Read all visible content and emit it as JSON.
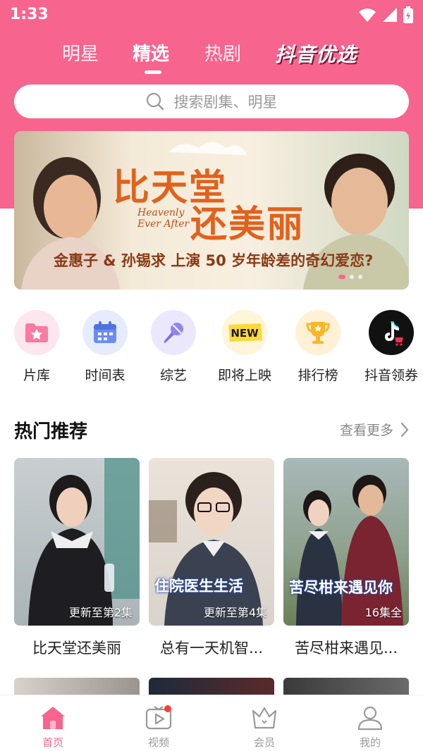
{
  "status_bar": {
    "time": "1:33"
  },
  "top_tabs": {
    "items": [
      "明星",
      "精选",
      "热剧"
    ],
    "active": "精选",
    "brand": "抖音优选"
  },
  "search": {
    "placeholder": "搜索剧集、明星"
  },
  "banner": {
    "title_line1": "比天堂",
    "title_line2": "还美丽",
    "english_title": "Heavenly Ever After",
    "subtitle": "金惠子 & 孙锡求 上演 50 岁年龄差的奇幻爱恋?"
  },
  "quick_nav": [
    {
      "label": "片库",
      "icon": "folder-star-icon"
    },
    {
      "label": "时间表",
      "icon": "calendar-icon"
    },
    {
      "label": "综艺",
      "icon": "microphone-icon"
    },
    {
      "label": "即将上映",
      "icon": "new-badge-icon"
    },
    {
      "label": "排行榜",
      "icon": "trophy-icon"
    },
    {
      "label": "抖音领券",
      "icon": "douyin-cart-icon"
    }
  ],
  "section": {
    "title": "热门推荐",
    "more_label": "查看更多"
  },
  "cards": [
    {
      "title": "比天堂还美丽",
      "badge": "更新至第2集"
    },
    {
      "title": "总有一天机智...",
      "badge": "更新至第4集",
      "poster_text": "住院医生生活"
    },
    {
      "title": "苦尽柑来遇见...",
      "badge": "16集全",
      "poster_text": "苦尽柑来遇见你"
    }
  ],
  "bottom_nav": [
    {
      "label": "首页",
      "icon": "home-icon",
      "active": true
    },
    {
      "label": "视频",
      "icon": "tv-play-icon",
      "active": false
    },
    {
      "label": "会员",
      "icon": "crown-icon",
      "active": false
    },
    {
      "label": "我的",
      "icon": "user-icon",
      "active": false
    }
  ],
  "colors": {
    "brand_pink": "#f7648e",
    "text_primary": "#222222",
    "text_secondary": "#888888"
  }
}
